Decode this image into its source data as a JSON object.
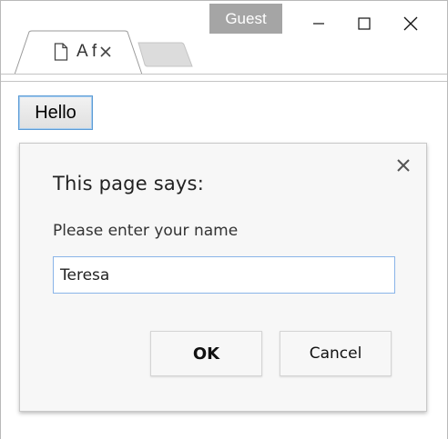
{
  "window": {
    "profile_badge": "Guest"
  },
  "tabs": [
    {
      "title": "A f",
      "icon": "page-icon"
    }
  ],
  "page": {
    "hello_button": "Hello"
  },
  "dialog": {
    "title": "This page says:",
    "message": "Please enter your name",
    "input_value": "Teresa",
    "ok_label": "OK",
    "cancel_label": "Cancel"
  },
  "colors": {
    "profile_badge_bg": "#a5a5a5",
    "focus_border": "#5b9bd5",
    "dialog_bg": "#f7f7f7"
  }
}
